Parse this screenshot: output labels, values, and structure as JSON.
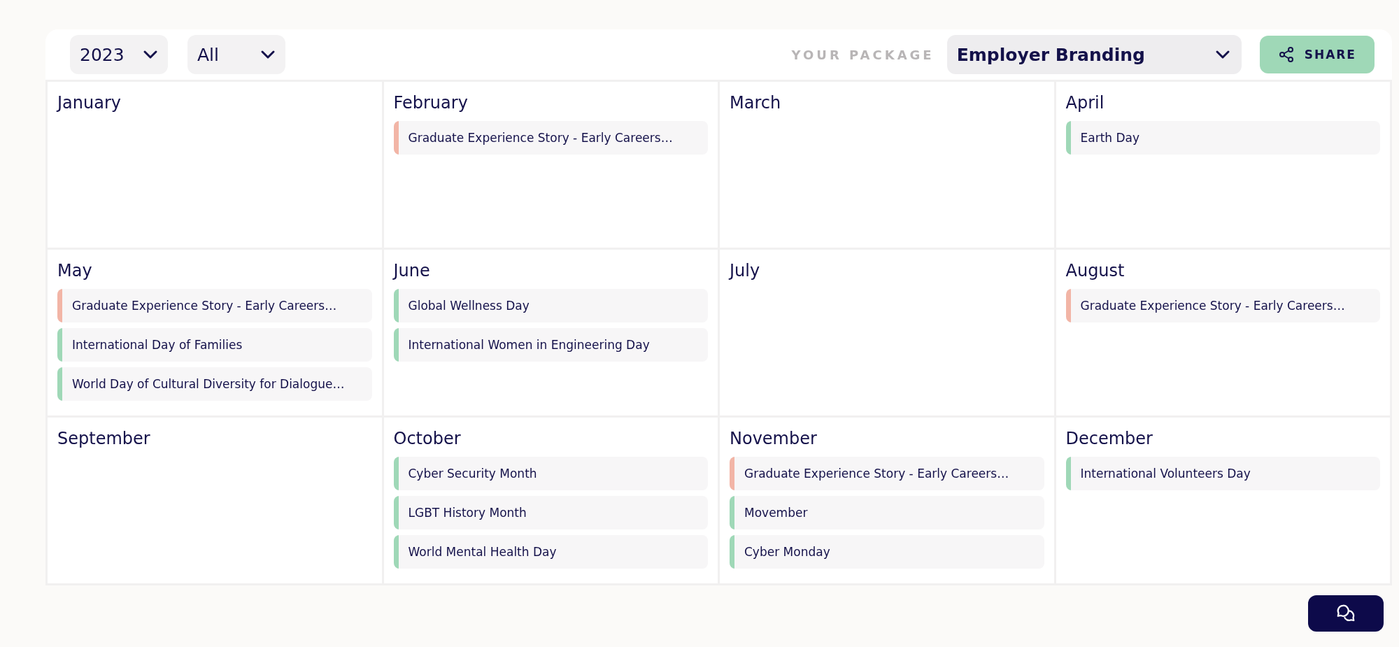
{
  "toolbar": {
    "year_filter": "2023",
    "category_filter": "All",
    "package_label": "YOUR PACKAGE",
    "package": "Employer Branding",
    "share_button": "SHARE"
  },
  "months": [
    {
      "name": "January"
    },
    {
      "name": "February",
      "events": [
        {
          "title": "Graduate Experience Story - Early Careers…",
          "color": "#f2b5a6"
        }
      ]
    },
    {
      "name": "March"
    },
    {
      "name": "April",
      "events": [
        {
          "title": "Earth Day",
          "color": "#9fd8b7"
        }
      ]
    },
    {
      "name": "May",
      "events": [
        {
          "title": "Graduate Experience Story - Early Careers…",
          "color": "#f2b5a6"
        },
        {
          "title": "International Day of Families",
          "color": "#9fd8b7"
        },
        {
          "title": "World Day of Cultural Diversity for Dialogue…",
          "color": "#9fd8b7"
        }
      ]
    },
    {
      "name": "June",
      "events": [
        {
          "title": "Global Wellness Day",
          "color": "#9fd8b7"
        },
        {
          "title": "International Women in Engineering Day",
          "color": "#9fd8b7"
        }
      ]
    },
    {
      "name": "July"
    },
    {
      "name": "August",
      "events": [
        {
          "title": "Graduate Experience Story - Early Careers…",
          "color": "#f2b5a6"
        }
      ]
    },
    {
      "name": "September"
    },
    {
      "name": "October",
      "events": [
        {
          "title": "Cyber Security Month",
          "color": "#9fd8b7"
        },
        {
          "title": "LGBT History Month",
          "color": "#9fd8b7"
        },
        {
          "title": "World Mental Health Day",
          "color": "#9fd8b7"
        }
      ]
    },
    {
      "name": "November",
      "events": [
        {
          "title": "Graduate Experience Story - Early Careers…",
          "color": "#f2b5a6"
        },
        {
          "title": "Movember",
          "color": "#9fd8b7"
        },
        {
          "title": "Cyber Monday",
          "color": "#9fd8b7"
        }
      ]
    },
    {
      "name": "December",
      "events": [
        {
          "title": "International Volunteers Day",
          "color": "#9fd8b7"
        }
      ]
    }
  ]
}
